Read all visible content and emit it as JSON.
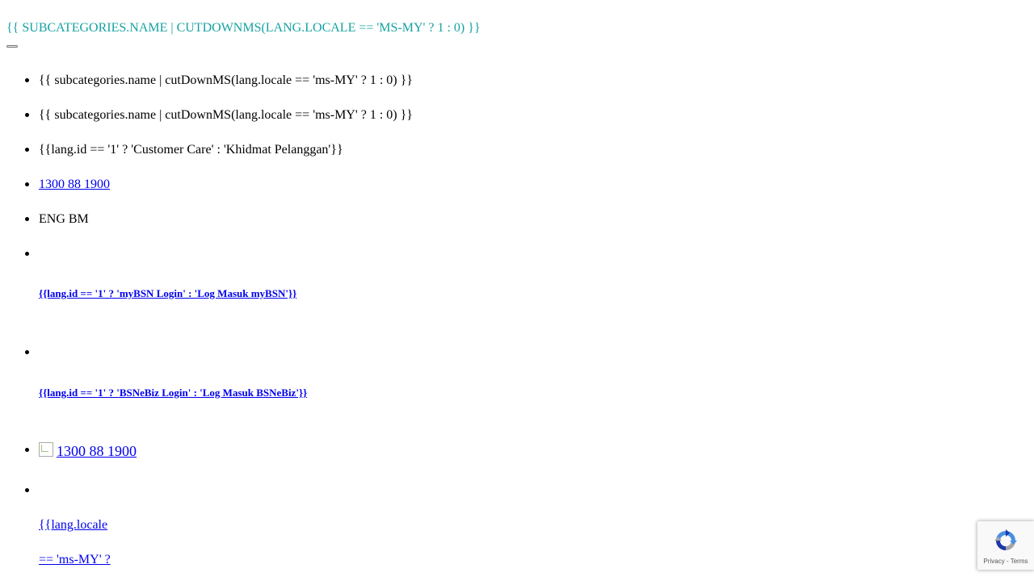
{
  "header": {
    "title": "{{ SUBCATEGORIES.NAME | CUTDOWNMS(LANG.LOCALE == 'MS-MY' ? 1 : 0) }}",
    "title_color": "#17a2a2"
  },
  "nav": {
    "items": [
      {
        "text": "{{ subcategories.name | cutDownMS(lang.locale == 'ms-MY' ? 1 : 0) }}"
      },
      {
        "text": "{{ subcategories.name | cutDownMS(lang.locale == 'ms-MY' ? 1 : 0) }}"
      },
      {
        "text": "{{lang.id == '1' ? 'Customer Care' : 'Khidmat Pelanggan'}}"
      },
      {
        "text": "1300 88 1900"
      },
      {
        "text": "ENG BM"
      },
      {
        "text": "{{lang.id == '1' ? 'myBSN Login' : 'Log Masuk myBSN'}}"
      },
      {
        "text": "{{lang.id == '1' ? 'BSNeBiz Login' : 'Log Masuk BSNeBiz'}}"
      },
      {
        "text": "1300 88 1900",
        "icon": "broken-image-icon"
      },
      {
        "line1": "{{lang.locale",
        "line2": "== 'ms-MY' ?"
      }
    ]
  },
  "recaptcha": {
    "privacy": "Privacy",
    "separator": " - ",
    "terms": "Terms",
    "icon": "recaptcha-logo-icon"
  },
  "colors": {
    "link": "#0000ee",
    "accent": "#17a2a2"
  }
}
